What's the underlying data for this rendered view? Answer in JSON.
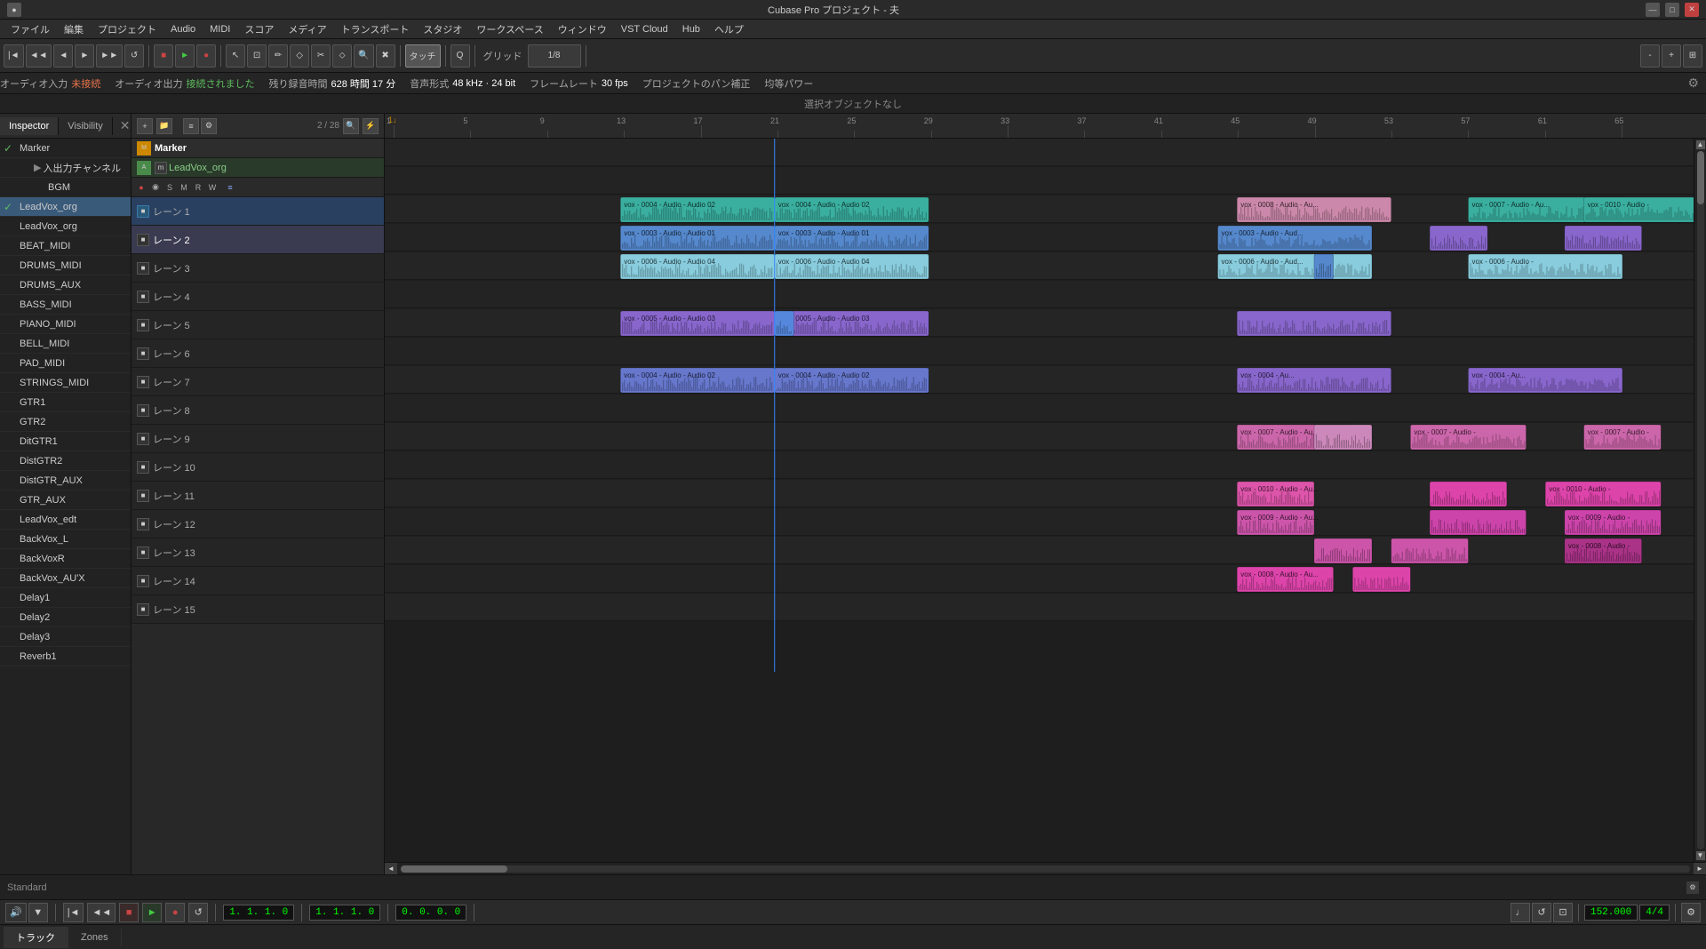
{
  "titlebar": {
    "title": "Cubase Pro プロジェクト - 夫",
    "minimize": "—",
    "maximize": "□",
    "close": "✕"
  },
  "menubar": {
    "items": [
      "ファイル",
      "編集",
      "プロジェクト",
      "Audio",
      "MIDI",
      "スコア",
      "メディア",
      "トランスポート",
      "スタジオ",
      "ワークスペース",
      "ウィンドウ",
      "VST Cloud",
      "Hub",
      "ヘルプ"
    ]
  },
  "toolbar": {
    "touch_label": "タッチ",
    "grid_label": "グリッド",
    "grid_value": "1/8"
  },
  "statusbar": {
    "audio_in": "オーディオ入力",
    "not_connected": "未接続",
    "audio_out": "オーディオ出力",
    "connected": "接続されました",
    "record_time": "残り録音時間",
    "time_value": "628 時間 17 分",
    "audio_format": "音声形式",
    "format_value": "48 kHz · 24 bit",
    "frame_rate_label": "フレームレート",
    "frame_rate_value": "30 fps",
    "pan_label": "プロジェクトのパン補正",
    "power_label": "均等パワー"
  },
  "selection_info": "選択オブジェクトなし",
  "panel_tabs": {
    "inspector": "Inspector",
    "visibility": "Visibility"
  },
  "tracks": [
    {
      "name": "Marker",
      "checked": true,
      "indent": 0
    },
    {
      "name": "入出力チャンネル",
      "checked": false,
      "indent": 1,
      "arrow": true
    },
    {
      "name": "BGM",
      "checked": false,
      "indent": 2
    },
    {
      "name": "LeadVox_org",
      "checked": true,
      "indent": 0
    },
    {
      "name": "LeadVox_org",
      "checked": false,
      "indent": 0
    },
    {
      "name": "BEAT_MIDI",
      "checked": false,
      "indent": 0
    },
    {
      "name": "DRUMS_MIDI",
      "checked": false,
      "indent": 0
    },
    {
      "name": "DRUMS_AUX",
      "checked": false,
      "indent": 0
    },
    {
      "name": "BASS_MIDI",
      "checked": false,
      "indent": 0
    },
    {
      "name": "PIANO_MIDI",
      "checked": false,
      "indent": 0
    },
    {
      "name": "BELL_MIDI",
      "checked": false,
      "indent": 0
    },
    {
      "name": "PAD_MIDI",
      "checked": false,
      "indent": 0
    },
    {
      "name": "STRINGS_MIDI",
      "checked": false,
      "indent": 0
    },
    {
      "name": "GTR1",
      "checked": false,
      "indent": 0
    },
    {
      "name": "GTR2",
      "checked": false,
      "indent": 0
    },
    {
      "name": "DitGTR1",
      "checked": false,
      "indent": 0
    },
    {
      "name": "DistGTR2",
      "checked": false,
      "indent": 0
    },
    {
      "name": "DistGTR_AUX",
      "checked": false,
      "indent": 0
    },
    {
      "name": "GTR_AUX",
      "checked": false,
      "indent": 0
    },
    {
      "name": "LeadVox_edt",
      "checked": false,
      "indent": 0
    },
    {
      "name": "BackVox_L",
      "checked": false,
      "indent": 0
    },
    {
      "name": "BackVoxR",
      "checked": false,
      "indent": 0
    },
    {
      "name": "BackVox_AUX",
      "checked": false,
      "indent": 0
    },
    {
      "name": "Delay1",
      "checked": false,
      "indent": 0
    },
    {
      "name": "Delay2",
      "checked": false,
      "indent": 0
    },
    {
      "name": "Delay3",
      "checked": false,
      "indent": 0
    },
    {
      "name": "Reverb1",
      "checked": false,
      "indent": 0
    }
  ],
  "track_header": {
    "marker_label": "Marker",
    "lead_vox_label": "LeadVox_org",
    "track_count": "2 / 28",
    "add_btn": "+",
    "folder_btn": "📁"
  },
  "lanes": [
    {
      "name": "レーン 1",
      "selected": false
    },
    {
      "name": "レーン 2",
      "selected": true
    },
    {
      "name": "レーン 3",
      "selected": false
    },
    {
      "name": "レーン 4",
      "selected": false
    },
    {
      "name": "レーン 5",
      "selected": false
    },
    {
      "name": "レーン 6",
      "selected": false
    },
    {
      "name": "レーン 7",
      "selected": false
    },
    {
      "name": "レーン 8",
      "selected": false
    },
    {
      "name": "レーン 9",
      "selected": false
    },
    {
      "name": "レーン 10",
      "selected": false
    },
    {
      "name": "レーン 11",
      "selected": false
    },
    {
      "name": "レーン 12",
      "selected": false
    },
    {
      "name": "レーン 13",
      "selected": false
    },
    {
      "name": "レーン 14",
      "selected": false
    },
    {
      "name": "レーン 15",
      "selected": false
    }
  ],
  "ruler": {
    "marks": [
      1,
      5,
      9,
      13,
      17,
      21,
      25,
      29,
      33,
      37,
      41,
      45,
      49,
      53,
      57,
      61,
      65
    ]
  },
  "transport": {
    "rewind_label": "◄◄",
    "play_label": "►",
    "stop_label": "■",
    "record_label": "●",
    "position": "1. 1. 1.  0",
    "position2": "1. 1. 1.  0",
    "position3": "0. 0. 0.  0",
    "tempo": "152.000",
    "time_sig": "4/4"
  },
  "bottom_tabs": {
    "track": "トラック",
    "zones": "Zones"
  },
  "footer": {
    "standard_label": "Standard"
  },
  "colors": {
    "teal_clip": "#3aafa0",
    "blue_clip": "#5588cc",
    "purple_clip": "#8866cc",
    "pink_clip": "#cc66aa",
    "magenta_clip": "#dd44aa",
    "selected_lane": "#2a4060"
  }
}
